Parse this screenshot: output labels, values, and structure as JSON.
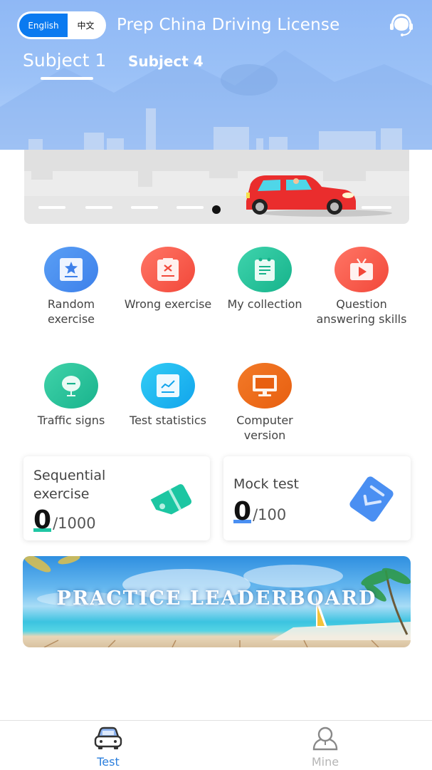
{
  "header": {
    "language_toggle": {
      "english_label": "English",
      "chinese_label": "中文",
      "selected": "English"
    },
    "app_title": "Prep China Driving License",
    "support_icon": "customer-service-headset-icon"
  },
  "subject_tabs": [
    {
      "label": "Subject 1",
      "active": true
    },
    {
      "label": "Subject 4",
      "active": false
    }
  ],
  "features": [
    {
      "label": "Random exercise",
      "icon": "star-card-icon",
      "color": "#4a8ff2"
    },
    {
      "label": "Wrong exercise",
      "icon": "x-clipboard-icon",
      "color": "#f45b4a"
    },
    {
      "label": "My collection",
      "icon": "notepad-icon",
      "color": "#1fc09a"
    },
    {
      "label": "Question answering skills",
      "icon": "video-tv-icon",
      "color": "#f45b4a"
    },
    {
      "label": "Traffic signs",
      "icon": "traffic-sign-icon",
      "color": "#22c29a"
    },
    {
      "label": "Test statistics",
      "icon": "line-chart-icon",
      "color": "#1fb4f0"
    },
    {
      "label": "Computer version",
      "icon": "monitor-icon",
      "color": "#ee6a1c"
    }
  ],
  "cards": {
    "sequential": {
      "title": "Sequential exercise",
      "done": "0",
      "total": "/1000",
      "icon": "tag-icon",
      "accent": "#1fc6a4"
    },
    "mock": {
      "title": "Mock test",
      "done": "0",
      "total": "/100",
      "icon": "check-paper-icon",
      "accent": "#4a8ff2"
    }
  },
  "leaderboard_banner": {
    "text": "PRACTICE LEADERBOARD"
  },
  "bottom_nav": [
    {
      "label": "Test",
      "icon": "car-icon",
      "active": true
    },
    {
      "label": "Mine",
      "icon": "user-icon",
      "active": false
    }
  ]
}
